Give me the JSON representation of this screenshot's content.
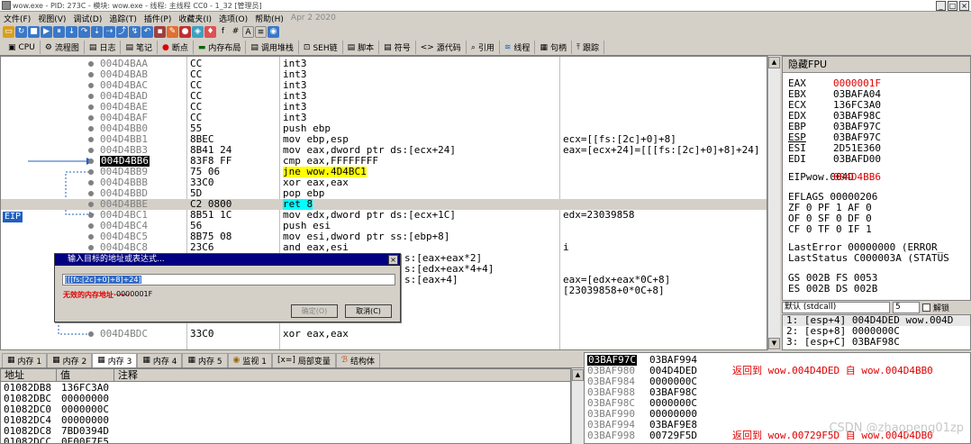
{
  "titlebar": {
    "title": "wow.exe - PID: 273C - 模块: wow.exe - 线程: 主线程 CC0 - 1_32 [管理员]"
  },
  "menu": {
    "items": [
      "文件(F)",
      "视图(V)",
      "调试(D)",
      "追踪(T)",
      "插件(P)",
      "收藏夹(I)",
      "选项(O)",
      "帮助(H)"
    ],
    "date": "Apr 2 2020"
  },
  "tabs": [
    {
      "icon": "▣",
      "label": "CPU"
    },
    {
      "icon": "⚙",
      "label": "流程图"
    },
    {
      "icon": "▤",
      "label": "日志"
    },
    {
      "icon": "▤",
      "label": "笔记"
    },
    {
      "icon": "●",
      "label": "断点"
    },
    {
      "icon": "▬",
      "label": "内存布局"
    },
    {
      "icon": "▤",
      "label": "调用堆栈"
    },
    {
      "icon": "⊡",
      "label": "SEH链"
    },
    {
      "icon": "▤",
      "label": "脚本"
    },
    {
      "icon": "▤",
      "label": "符号"
    },
    {
      "icon": "<>",
      "label": "源代码"
    },
    {
      "icon": "⌕",
      "label": "引用"
    },
    {
      "icon": "≋",
      "label": "线程"
    },
    {
      "icon": "▦",
      "label": "句柄"
    },
    {
      "icon": "⤒",
      "label": "跟踪"
    }
  ],
  "disasm": {
    "eip_label": "EIP",
    "rows": [
      {
        "addr": "004D4BAA",
        "bytes": "CC",
        "ins": "int3",
        "cmt": ""
      },
      {
        "addr": "004D4BAB",
        "bytes": "CC",
        "ins": "int3",
        "cmt": ""
      },
      {
        "addr": "004D4BAC",
        "bytes": "CC",
        "ins": "int3",
        "cmt": ""
      },
      {
        "addr": "004D4BAD",
        "bytes": "CC",
        "ins": "int3",
        "cmt": ""
      },
      {
        "addr": "004D4BAE",
        "bytes": "CC",
        "ins": "int3",
        "cmt": ""
      },
      {
        "addr": "004D4BAF",
        "bytes": "CC",
        "ins": "int3",
        "cmt": ""
      },
      {
        "addr": "004D4BB0",
        "bytes": "55",
        "ins": "push ebp",
        "cmt": ""
      },
      {
        "addr": "004D4BB1",
        "bytes": "8BEC",
        "ins": "mov ebp,esp",
        "cmt": "ecx=[[fs:[2c]+0]+8]"
      },
      {
        "addr": "004D4BB3",
        "bytes": "8B41 24",
        "ins": "mov eax,dword ptr ds:[ecx+24]",
        "cmt": "eax=[ecx+24]=[[[fs:[2c]+0]+8]+24]"
      },
      {
        "addr": "004D4BB6",
        "bytes": "83F8 FF",
        "ins": "cmp eax,FFFFFFFF",
        "cmt": ""
      },
      {
        "addr": "004D4BB9",
        "bytes": "75 06",
        "ins": "jne wow.4D4BC1",
        "cmt": ""
      },
      {
        "addr": "004D4BBB",
        "bytes": "33C0",
        "ins": "xor eax,eax",
        "cmt": ""
      },
      {
        "addr": "004D4BBD",
        "bytes": "5D",
        "ins": "pop ebp",
        "cmt": ""
      },
      {
        "addr": "004D4BBE",
        "bytes": "C2 0800",
        "ins": "ret 8",
        "cmt": ""
      },
      {
        "addr": "004D4BC1",
        "bytes": "8B51 1C",
        "ins": "mov edx,dword ptr ds:[ecx+1C]",
        "cmt": "edx=23039858"
      },
      {
        "addr": "004D4BC4",
        "bytes": "56",
        "ins": "push esi",
        "cmt": ""
      },
      {
        "addr": "004D4BC5",
        "bytes": "8B75 08",
        "ins": "mov esi,dword ptr ss:[ebp+8]",
        "cmt": ""
      },
      {
        "addr": "004D4BC8",
        "bytes": "23C6",
        "ins": "and eax,esi",
        "cmt": "i"
      },
      {
        "addr": "",
        "bytes": "",
        "ins": "s:[eax+eax*2]",
        "cmt": ""
      },
      {
        "addr": "",
        "bytes": "",
        "ins": "s:[edx+eax*4+4]",
        "cmt": ""
      },
      {
        "addr": "",
        "bytes": "",
        "ins": "s:[eax+4]",
        "cmt": "eax=[edx+eax*0C+8]"
      },
      {
        "addr": "",
        "bytes": "",
        "ins": "",
        "cmt": "[23039858+0*0C+8]"
      },
      {
        "addr": "",
        "bytes": "",
        "ins": "",
        "cmt": ""
      },
      {
        "addr": "",
        "bytes": "",
        "ins": "",
        "cmt": ""
      },
      {
        "addr": "004D4BDC",
        "bytes": "33C0",
        "ins": "xor eax,eax",
        "cmt": ""
      }
    ]
  },
  "registers": {
    "header": "隐藏FPU",
    "list": [
      {
        "n": "EAX",
        "v": "0000001F",
        "red": true
      },
      {
        "n": "EBX",
        "v": "03BAFA04",
        "red": false
      },
      {
        "n": "ECX",
        "v": "136FC3A0",
        "red": false
      },
      {
        "n": "EDX",
        "v": "03BAF98C",
        "red": false
      },
      {
        "n": "EBP",
        "v": "03BAF97C",
        "red": false
      },
      {
        "n": "ESP",
        "v": "03BAF97C",
        "red": false
      },
      {
        "n": "ESI",
        "v": "2D51E360",
        "red": false
      },
      {
        "n": "EDI",
        "v": "03BAFD00",
        "red": false
      }
    ],
    "eip_name": "EIP",
    "eip_val": "004D4BB6",
    "eip_mod": "wow.004D",
    "eflags": "EFLAGS   00000206",
    "flags1": "ZF 0  PF 1  AF 0",
    "flags2": "OF 0  SF 0  DF 0",
    "flags3": "CF 0  TF 0  IF 1",
    "lasterr": "LastError  00000000 (ERROR_",
    "laststat": "LastStatus C000003A (STATUS",
    "seg1": "GS 002B  FS 0053",
    "seg2": "ES 002B  DS 002B"
  },
  "stackctl": {
    "conv": "默认 (stdcall)",
    "count": "5",
    "unlock": "解锁"
  },
  "callstack": [
    "1: [esp+4]  004D4DED wow.004D",
    "2: [esp+8]  0000000C",
    "3: [esp+C]  03BAF98C"
  ],
  "dialog": {
    "title": "输入目标的地址或表达式...",
    "value": "[[[fs:[2c]+0]+8]+24]",
    "error": "无效的内存地址······",
    "errval": "0000001F",
    "ok": "确定(O)",
    "cancel": "取消(C)"
  },
  "bottom_tabs": [
    "内存 1",
    "内存 2",
    "内存 3",
    "内存 4",
    "内存 5",
    "监视 1",
    "局部变量",
    "结构体"
  ],
  "dump": {
    "headers": [
      "地址",
      "值",
      "注释"
    ],
    "rows": [
      {
        "a": "01082DB8",
        "v": "136FC3A0"
      },
      {
        "a": "01082DBC",
        "v": "00000000"
      },
      {
        "a": "01082DC0",
        "v": "0000000C"
      },
      {
        "a": "01082DC4",
        "v": "00000000"
      },
      {
        "a": "01082DC8",
        "v": "7BD0394D"
      },
      {
        "a": "01082DCC",
        "v": "0E00F7E5"
      }
    ]
  },
  "stack": {
    "rows": [
      {
        "a": "03BAF97C",
        "v": "03BAF994",
        "c": "",
        "sel": true
      },
      {
        "a": "03BAF980",
        "v": "004D4DED",
        "c": "返回到 wow.004D4DED 自 wow.004D4BB0",
        "sel": false
      },
      {
        "a": "03BAF984",
        "v": "0000000C",
        "c": "",
        "sel": false
      },
      {
        "a": "03BAF988",
        "v": "03BAF98C",
        "c": "",
        "sel": false
      },
      {
        "a": "03BAF98C",
        "v": "0000000C",
        "c": "",
        "sel": false
      },
      {
        "a": "03BAF990",
        "v": "00000000",
        "c": "",
        "sel": false
      },
      {
        "a": "03BAF994",
        "v": "03BAF9E8",
        "c": "",
        "sel": false
      },
      {
        "a": "03BAF998",
        "v": "00729F5D",
        "c": "返回到 wow.00729F5D 自 wow.004D4DB0",
        "sel": false
      }
    ]
  },
  "watermark": "CSDN @zhaopeng01zp"
}
